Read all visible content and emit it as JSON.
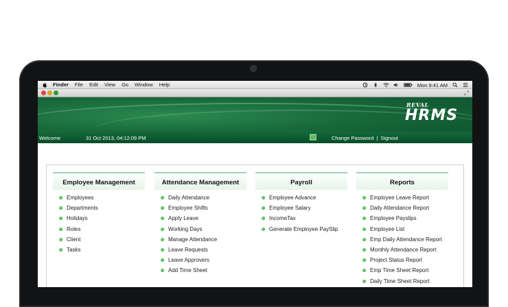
{
  "menubar": {
    "app": "Finder",
    "items": [
      "File",
      "Edit",
      "View",
      "Go",
      "Window",
      "Help"
    ],
    "clock": "Mon 9:41 AM",
    "icons": [
      "time-machine-icon",
      "bluetooth-icon",
      "wifi-icon",
      "volume-icon",
      "battery-icon",
      "spotlight-icon",
      "menu-list-icon"
    ]
  },
  "header": {
    "logo_top": "REVAL",
    "logo_main": "HRMS",
    "welcome": "Welcome",
    "datetime": "31 Oct 2013, 04:12:09 PM",
    "change_password": "Change Password",
    "separator": "|",
    "signout": "Signout"
  },
  "columns": [
    {
      "title": "Employee Management",
      "items": [
        "Employees",
        "Departments",
        "Holidays",
        "Roles",
        "Client",
        "Tasks"
      ]
    },
    {
      "title": "Attendance Management",
      "items": [
        "Daily Attendance",
        "Employee Shifts",
        "Apply Leave",
        "Working Days",
        "Manage Attendance",
        "Leave Requests",
        "Leave Approvers",
        "Add Time Sheet"
      ]
    },
    {
      "title": "Payroll",
      "items": [
        "Employee Advance",
        "Employee Salary",
        "IncomeTax",
        "Generate Employee PaySlip"
      ]
    },
    {
      "title": "Reports",
      "items": [
        "Employee Leave Report",
        "Daily Attendance Report",
        "Employee Payslips",
        "Employee List",
        "Emp Daily Attendance Report",
        "Monthly Attendance Report",
        "Project Status Report",
        "Emp Time Sheet Report",
        "Daily Time Sheet Report"
      ]
    }
  ],
  "colors": {
    "header_green": "#17683a",
    "bar_green": "#0a4d29",
    "bullet_green": "#1e8a2a"
  }
}
